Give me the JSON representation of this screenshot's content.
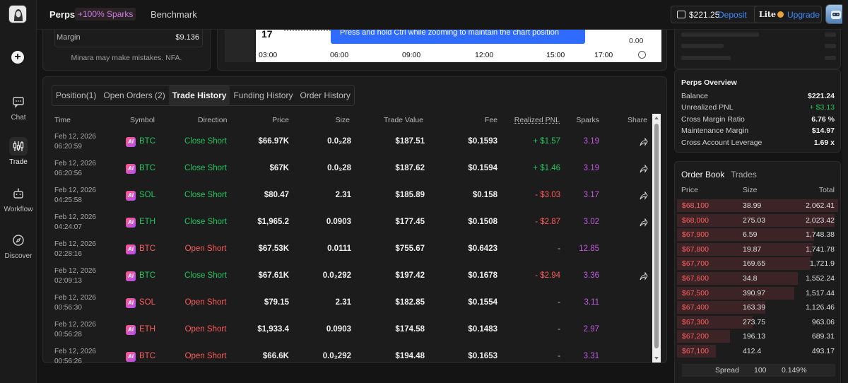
{
  "nav": {
    "items": [
      {
        "label": "Chat"
      },
      {
        "label": "Trade"
      },
      {
        "label": "Workflow"
      },
      {
        "label": "Discover"
      }
    ]
  },
  "topbar": {
    "title": "Perps",
    "badge": "+100% Sparks",
    "benchmark": "Benchmark",
    "balance": "$221.25",
    "deposit": "Deposit",
    "plan": "Lite",
    "upgrade": "Upgrade"
  },
  "summary": {
    "margin_label": "Margin",
    "margin_value": "$9.136",
    "disclaimer": "Minara may make mistakes. NFA."
  },
  "chart": {
    "tooltip": "Press and hold Ctrl while zooming to maintain the chart position",
    "y_tick": "0.00",
    "corner_label": "17",
    "time_ticks": [
      "03:00",
      "06:00",
      "09:00",
      "12:00",
      "15:00",
      "17:00"
    ]
  },
  "trades": {
    "tabs": [
      "Position(1)",
      "Open Orders (2)",
      "Trade History",
      "Funding History",
      "Order History"
    ],
    "active_tab": "Trade History",
    "columns": {
      "time": "Time",
      "symbol": "Symbol",
      "direction": "Direction",
      "price": "Price",
      "size": "Size",
      "trade_value": "Trade Value",
      "fee": "Fee",
      "realized_pnl": "Realized PNL",
      "sparks": "Sparks",
      "share": "Share"
    },
    "rows": [
      {
        "date": "Feb 12, 2026",
        "time": "06:20:59",
        "symbol": "BTC",
        "direction": "Close Short",
        "price": "$66.97K",
        "size": "0.0₂28",
        "value": "$187.51",
        "fee": "$0.1593",
        "pnl": "+ $1.57",
        "sparks": "3.19",
        "share": true
      },
      {
        "date": "Feb 12, 2026",
        "time": "06:20:56",
        "symbol": "BTC",
        "direction": "Close Short",
        "price": "$67K",
        "size": "0.0₂28",
        "value": "$187.62",
        "fee": "$0.1594",
        "pnl": "+ $1.46",
        "sparks": "3.19",
        "share": true
      },
      {
        "date": "Feb 12, 2026",
        "time": "04:25:58",
        "symbol": "SOL",
        "direction": "Close Short",
        "price": "$80.47",
        "size": "2.31",
        "value": "$185.89",
        "fee": "$0.158",
        "pnl": "- $3.03",
        "sparks": "3.17",
        "share": true
      },
      {
        "date": "Feb 12, 2026",
        "time": "04:24:07",
        "symbol": "ETH",
        "direction": "Close Short",
        "price": "$1,965.2",
        "size": "0.0903",
        "value": "$177.45",
        "fee": "$0.1508",
        "pnl": "- $2.87",
        "sparks": "3.02",
        "share": true
      },
      {
        "date": "Feb 12, 2026",
        "time": "02:28:16",
        "symbol": "BTC",
        "direction": "Open Short",
        "price": "$67.53K",
        "size": "0.0111",
        "value": "$755.67",
        "fee": "$0.6423",
        "pnl": "-",
        "sparks": "12.85",
        "share": false
      },
      {
        "date": "Feb 12, 2026",
        "time": "02:09:13",
        "symbol": "BTC",
        "direction": "Close Short",
        "price": "$67.61K",
        "size": "0.0₂292",
        "value": "$197.42",
        "fee": "$0.1678",
        "pnl": "- $2.94",
        "sparks": "3.36",
        "share": true
      },
      {
        "date": "Feb 12, 2026",
        "time": "00:56:30",
        "symbol": "SOL",
        "direction": "Open Short",
        "price": "$79.15",
        "size": "2.31",
        "value": "$182.85",
        "fee": "$0.1554",
        "pnl": "-",
        "sparks": "3.11",
        "share": false
      },
      {
        "date": "Feb 12, 2026",
        "time": "00:56:28",
        "symbol": "ETH",
        "direction": "Open Short",
        "price": "$1,933.4",
        "size": "0.0903",
        "value": "$174.58",
        "fee": "$0.1483",
        "pnl": "-",
        "sparks": "2.97",
        "share": false
      },
      {
        "date": "Feb 12, 2026",
        "time": "00:56:26",
        "symbol": "BTC",
        "direction": "Open Short",
        "price": "$66.6K",
        "size": "0.0₂292",
        "value": "$194.48",
        "fee": "$0.1653",
        "pnl": "-",
        "sparks": "3.31",
        "share": false
      }
    ]
  },
  "perps_overview": {
    "title": "Perps Overview",
    "rows": [
      {
        "label": "Balance",
        "value": "$221.24",
        "tone": "normal"
      },
      {
        "label": "Unrealized PNL",
        "value": "+ $3.13",
        "tone": "green"
      },
      {
        "label": "Cross Margin Ratio",
        "value": "6.76 %",
        "tone": "normal"
      },
      {
        "label": "Maintenance Margin",
        "value": "$14.97",
        "tone": "normal"
      },
      {
        "label": "Cross Account Leverage",
        "value": "1.69 x",
        "tone": "normal"
      }
    ]
  },
  "order_book": {
    "tab_book": "Order Book",
    "tab_trades": "Trades",
    "header": {
      "price": "Price",
      "size": "Size",
      "total": "Total"
    },
    "rows": [
      {
        "price": "$68,100",
        "size": "38.99",
        "total": "2,062.41",
        "depth": 1.0
      },
      {
        "price": "$68,000",
        "size": "275.03",
        "total": "2,023.42",
        "depth": 0.98
      },
      {
        "price": "$67,900",
        "size": "6.59",
        "total": "1,748.38",
        "depth": 0.85
      },
      {
        "price": "$67,800",
        "size": "19.87",
        "total": "1,741.78",
        "depth": 0.84
      },
      {
        "price": "$67,700",
        "size": "169.65",
        "total": "1,721.9",
        "depth": 0.83
      },
      {
        "price": "$67,600",
        "size": "34.8",
        "total": "1,552.24",
        "depth": 0.75
      },
      {
        "price": "$67,500",
        "size": "390.97",
        "total": "1,517.44",
        "depth": 0.73
      },
      {
        "price": "$67,400",
        "size": "163.39",
        "total": "1,126.46",
        "depth": 0.55
      },
      {
        "price": "$67,300",
        "size": "273.75",
        "total": "963.06",
        "depth": 0.47
      },
      {
        "price": "$67,200",
        "size": "196.13",
        "total": "689.31",
        "depth": 0.33
      },
      {
        "price": "$67,100",
        "size": "412.4",
        "total": "493.17",
        "depth": 0.24
      }
    ],
    "spread_label": "Spread",
    "spread_value": "100",
    "spread_pct": "0.149%"
  },
  "colors": {
    "green": "#22c55e",
    "red": "#ff5b5b",
    "accent": "#3d8bff",
    "sparks": "#c05ce0"
  }
}
